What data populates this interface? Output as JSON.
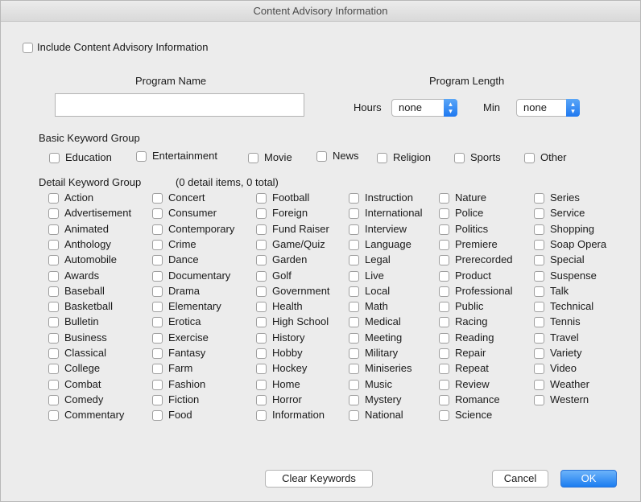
{
  "window": {
    "title": "Content Advisory Information"
  },
  "include_checkbox": {
    "label": "Include Content Advisory Information"
  },
  "program_name": {
    "label": "Program Name",
    "value": ""
  },
  "program_length": {
    "label": "Program Length",
    "hours_label": "Hours",
    "hours_value": "none",
    "min_label": "Min",
    "min_value": "none"
  },
  "basic_group": {
    "label": "Basic Keyword Group",
    "items": [
      "Education",
      "Entertainment",
      "Movie",
      "News",
      "Religion",
      "Sports",
      "Other"
    ]
  },
  "detail_group": {
    "label": "Detail Keyword Group",
    "count_text": "(0 detail items, 0 total)",
    "columns": [
      [
        "Action",
        "Advertisement",
        "Animated",
        "Anthology",
        "Automobile",
        "Awards",
        "Baseball",
        "Basketball",
        "Bulletin",
        "Business",
        "Classical",
        "College",
        "Combat",
        "Comedy",
        "Commentary"
      ],
      [
        "Concert",
        "Consumer",
        "Contemporary",
        "Crime",
        "Dance",
        "Documentary",
        "Drama",
        "Elementary",
        "Erotica",
        "Exercise",
        "Fantasy",
        "Farm",
        "Fashion",
        "Fiction",
        "Food"
      ],
      [
        "Football",
        "Foreign",
        "Fund Raiser",
        "Game/Quiz",
        "Garden",
        "Golf",
        "Government",
        "Health",
        "High School",
        "History",
        "Hobby",
        "Hockey",
        "Home",
        "Horror",
        "Information"
      ],
      [
        "Instruction",
        "International",
        "Interview",
        "Language",
        "Legal",
        "Live",
        "Local",
        "Math",
        "Medical",
        "Meeting",
        "Military",
        "Miniseries",
        "Music",
        "Mystery",
        "National"
      ],
      [
        "Nature",
        "Police",
        "Politics",
        "Premiere",
        "Prerecorded",
        "Product",
        "Professional",
        "Public",
        "Racing",
        "Reading",
        "Repair",
        "Repeat",
        "Review",
        "Romance",
        "Science"
      ],
      [
        "Series",
        "Service",
        "Shopping",
        "Soap Opera",
        "Special",
        "Suspense",
        "Talk",
        "Technical",
        "Tennis",
        "Travel",
        "Variety",
        "Video",
        "Weather",
        "Western"
      ]
    ]
  },
  "buttons": {
    "clear": "Clear Keywords",
    "cancel": "Cancel",
    "ok": "OK"
  }
}
